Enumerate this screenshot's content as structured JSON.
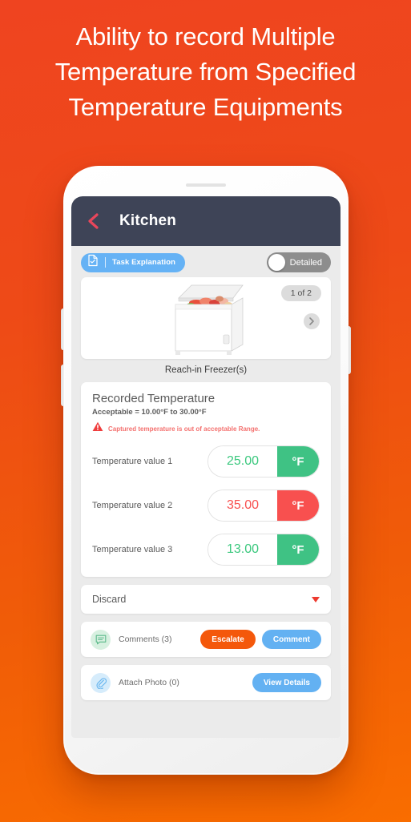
{
  "headline": "Ability to record Multiple Temperature from Specified Temperature Equipments",
  "colors": {
    "background_top": "#ef4420",
    "background_bottom": "#f96d00",
    "navbar": "#3e4457",
    "back_arrow": "#e8465b",
    "accent_blue": "#65b2f5",
    "accent_orange": "#f4580b",
    "ok_green": "#3fc284",
    "error_red": "#f8504f",
    "warning_text": "#f4706e"
  },
  "navbar": {
    "back_icon": "chevron-left-icon",
    "title": "Kitchen"
  },
  "toolbar": {
    "task_explanation": {
      "icon": "document-check-icon",
      "label": "Task Explanation"
    },
    "detailed_toggle": {
      "label": "Detailed",
      "state": "off"
    }
  },
  "carousel": {
    "image_alt": "chest-freezer-open-with-food",
    "counter": "1 of 2",
    "next_icon": "chevron-right-icon",
    "caption": "Reach-in Freezer(s)"
  },
  "temperature": {
    "title": "Recorded Temperature",
    "acceptable": "Acceptable = 10.00°F to 30.00°F",
    "warning_icon": "warning-triangle-icon",
    "warning": "Captured temperature is out of acceptable Range.",
    "rows": [
      {
        "label": "Temperature value 1",
        "value": "25.00",
        "unit": "°F",
        "status": "ok"
      },
      {
        "label": "Temperature value 2",
        "value": "35.00",
        "unit": "°F",
        "status": "bad"
      },
      {
        "label": "Temperature value 3",
        "value": "13.00",
        "unit": "°F",
        "status": "ok"
      }
    ]
  },
  "action_select": {
    "value": "Discard",
    "caret_icon": "caret-down-icon"
  },
  "comments": {
    "icon": "speech-bubble-icon",
    "label": "Comments (3)",
    "escalate_label": "Escalate",
    "comment_label": "Comment"
  },
  "attachment": {
    "icon": "paperclip-icon",
    "label": "Attach Photo (0)",
    "view_details_label": "View Details"
  }
}
